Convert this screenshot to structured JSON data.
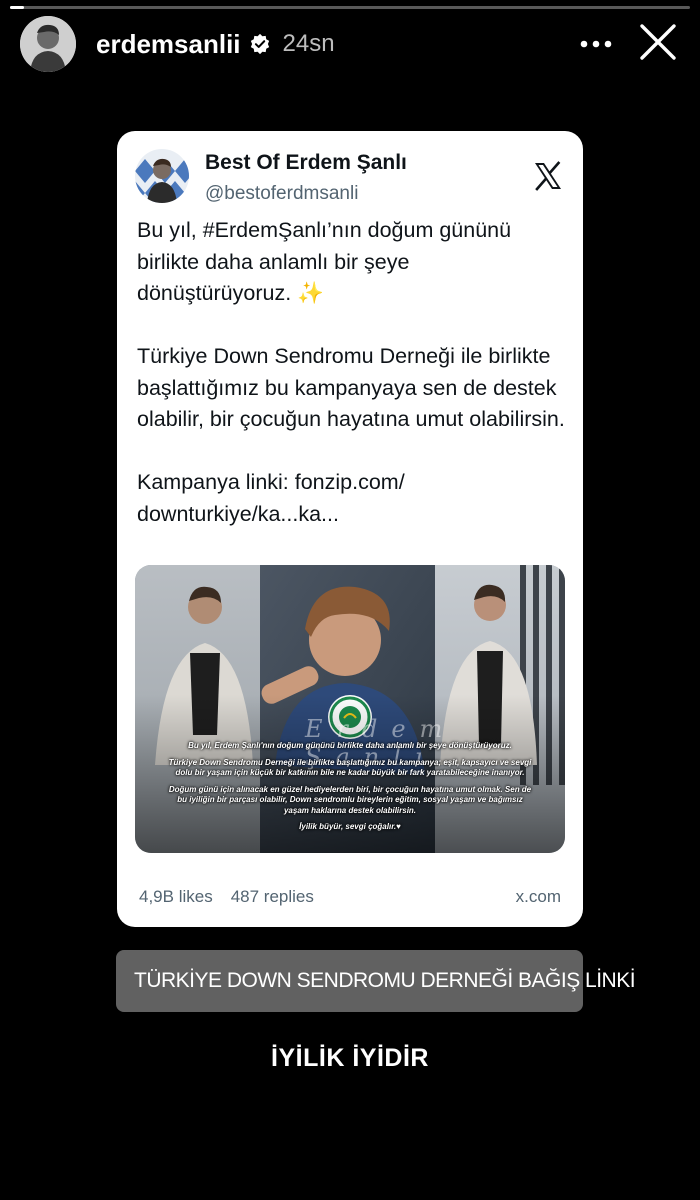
{
  "story": {
    "progress": 0.02,
    "username": "erdemsanlii",
    "verified": true,
    "time": "24sn"
  },
  "post": {
    "display_name": "Best Of Erdem Şanlı",
    "handle": "@bestoferdmsanli",
    "paragraph1": "Bu yıl, #ErdemŞanlı’nın doğum gününü birlikte daha anlamlı bir şeye dönüştürüyoruz.",
    "paragraph1_emoji": "✨",
    "paragraph2": "Türkiye Down Sendromu Derneği ile birlikte başlattığımız bu kampanyaya sen de destek olabilir, bir çocuğun hayatına umut olabilirsin.",
    "paragraph3": "Kampanya linki: fonzip.com/ downturkiye/ka...ka...",
    "likes": "4,9B likes",
    "replies": "487 replies",
    "domain": "x.com",
    "media": {
      "signature": "Erdem Şanlı",
      "lines": [
        "Bu yıl, Erdem Şanlı'nın doğum gününü birlikte daha anlamlı bir şeye dönüştürüyoruz.",
        "Türkiye Down Sendromu Derneği ile birlikte başlattığımız bu kampanya; eşit, kapsayıcı ve sevgi dolu bir yaşam için küçük bir katkının bile ne kadar büyük bir fark yaratabileceğine inanıyor.",
        "Doğum günü için alınacak en güzel hediyelerden biri, bir çocuğun hayatına umut olmak. Sen de bu iyiliğin bir parçası olabilir, Down sendromlu bireylerin eğitim, sosyal yaşam ve bağımsız yaşam haklarına destek olabilirsin.",
        "İyilik büyür, sevgi çoğalır.♥"
      ],
      "badge_text": "TDSD"
    }
  },
  "link_sticker": {
    "label": "TÜRKİYE DOWN SENDROMU DERNEĞİ BAĞIŞ LİNKİ"
  },
  "caption": "İYİLİK İYİDİR",
  "colors": {
    "background": "#000000",
    "card": "#ffffff",
    "verified": "#3897f0",
    "secondary_text": "#536471"
  },
  "icons": [
    "verified-badge-icon",
    "more-options-icon",
    "close-icon",
    "x-logo-icon",
    "link-icon"
  ]
}
